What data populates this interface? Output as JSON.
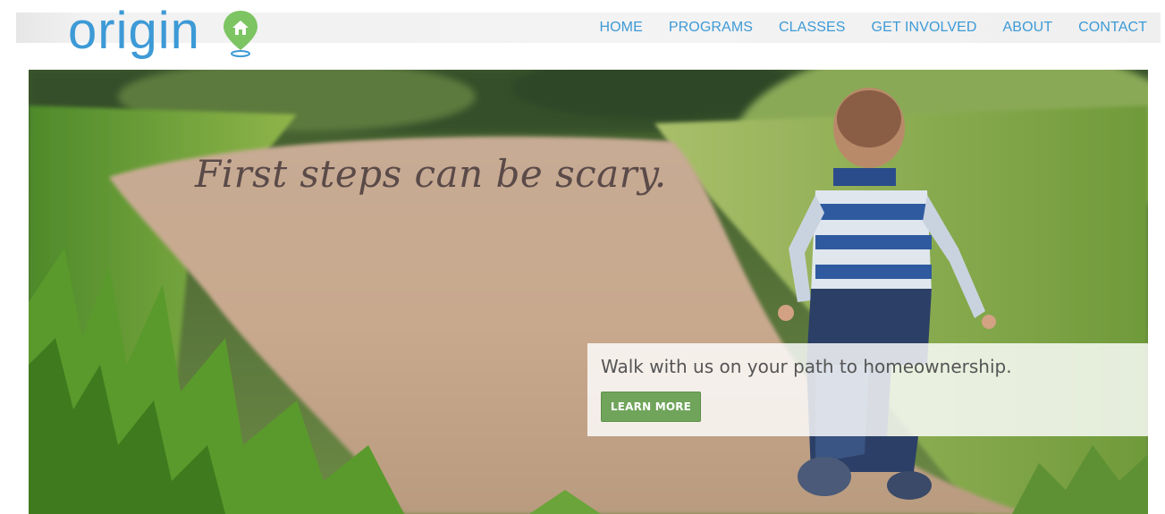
{
  "brand": {
    "name": "origin",
    "logo_color": "#3d9ad6",
    "pin_color": "#7dc462",
    "pin_icon": "home-icon"
  },
  "nav": {
    "items": [
      {
        "label": "HOME"
      },
      {
        "label": "PROGRAMS"
      },
      {
        "label": "CLASSES"
      },
      {
        "label": "GET INVOLVED"
      },
      {
        "label": "ABOUT"
      },
      {
        "label": "CONTACT"
      }
    ],
    "color": "#3d9ad6"
  },
  "hero": {
    "headline": "First steps can be scary.",
    "subtext": "Walk with us on your path to homeownership.",
    "cta_label": "LEARN MORE",
    "cta_color": "#6fa45a"
  }
}
